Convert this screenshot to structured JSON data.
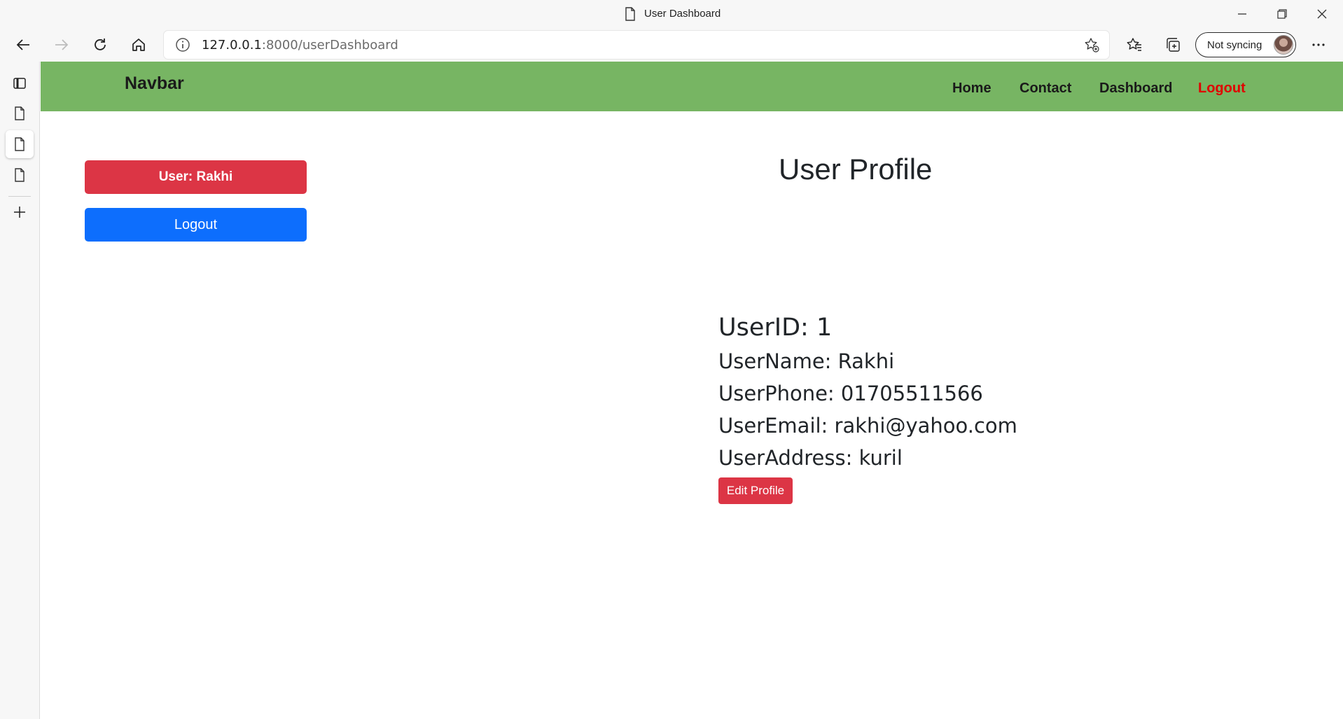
{
  "window": {
    "title": "User Dashboard"
  },
  "browser": {
    "url_host": "127.0.0.1",
    "url_path": ":8000/userDashboard",
    "sync_label": "Not syncing"
  },
  "navbar": {
    "brand": "Navbar",
    "links": [
      "Home",
      "Contact",
      "Dashboard",
      "Logout"
    ],
    "background_color": "#77b563",
    "logout_color": "#e00000"
  },
  "sidebar": {
    "user_button": "User: Rakhi",
    "logout_button": "Logout"
  },
  "profile": {
    "title": "User Profile",
    "user_id": "UserID: 1",
    "user_name": "UserName: Rakhi",
    "user_phone": "UserPhone: 01705511566",
    "user_email": "UserEmail: rakhi@yahoo.com",
    "user_address": "UserAddress: kuril",
    "edit_button": "Edit Profile"
  },
  "colors": {
    "danger": "#dc3545",
    "primary": "#0d6efd"
  }
}
